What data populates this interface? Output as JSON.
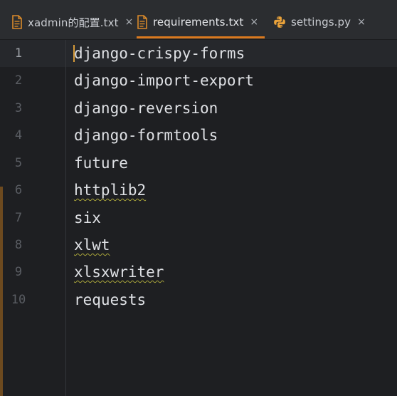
{
  "tabs": [
    {
      "label": "xadmin的配置.txt",
      "icon": "text-file-icon",
      "active": false,
      "close": "×"
    },
    {
      "label": "requirements.txt",
      "icon": "text-file-icon",
      "active": true,
      "close": "×"
    },
    {
      "label": "settings.py",
      "icon": "python-icon",
      "active": false,
      "close": "×"
    }
  ],
  "editor": {
    "lines": [
      {
        "number": "1",
        "text": "django-crispy-forms"
      },
      {
        "number": "2",
        "text": "django-import-export"
      },
      {
        "number": "3",
        "text": "django-reversion"
      },
      {
        "number": "4",
        "text": "django-formtools"
      },
      {
        "number": "5",
        "text": "future"
      },
      {
        "number": "6",
        "text": "httplib2"
      },
      {
        "number": "7",
        "text": "six"
      },
      {
        "number": "8",
        "text": "xlwt"
      },
      {
        "number": "9",
        "text": "xlsxwriter"
      },
      {
        "number": "10",
        "text": "requests"
      }
    ],
    "current_line": "1",
    "spellcheck_underlined": [
      "httplib2",
      "xlwt",
      "xlsxwriter"
    ]
  },
  "colors": {
    "accent": "#d9791f",
    "background": "#1e1f22",
    "tabbar": "#2b2d30",
    "text": "#dfe1e5",
    "line_number": "#5a5d63",
    "typo_underline": "#a8a43a"
  }
}
